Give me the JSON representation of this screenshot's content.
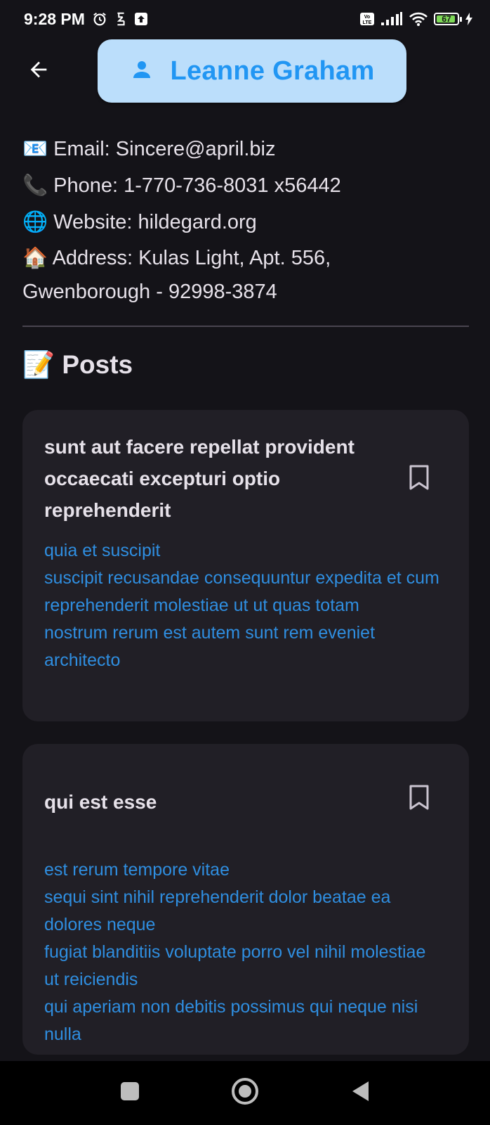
{
  "status_bar": {
    "time": "9:28 PM",
    "battery_percent": "67",
    "icons": [
      "alarm-icon",
      "data-saver-icon",
      "upload-icon",
      "volte-icon",
      "signal-icon",
      "wifi-icon",
      "battery-icon",
      "charging-icon"
    ]
  },
  "header": {
    "back_icon": "arrow-back-icon",
    "user_icon": "person-icon",
    "name": "Leanne Graham",
    "chip_bg": "#bbdefb",
    "chip_fg": "#2196f3"
  },
  "contact": {
    "email": "📧 Email: Sincere@april.biz",
    "phone": "📞 Phone: 1-770-736-8031 x56442",
    "website": "🌐 Website: hildegard.org",
    "address_line1": "🏠 Address: Kulas Light, Apt. 556,",
    "address_line2": "Gwenborough - 92998-3874"
  },
  "posts_heading": "📝 Posts",
  "posts": [
    {
      "title": "sunt aut facere repellat provident occaecati excepturi optio reprehenderit",
      "body_lines": [
        "quia et suscipit",
        "suscipit recusandae consequuntur expedita et cum",
        "reprehenderit molestiae ut ut quas totam",
        "nostrum rerum est autem sunt rem eveniet architecto"
      ],
      "bookmark_icon": "bookmark-outline-icon"
    },
    {
      "title": "qui est esse",
      "body_lines": [
        "est rerum tempore vitae",
        "sequi sint nihil reprehenderit dolor beatae ea dolores neque",
        "fugiat blanditiis voluptate porro vel nihil molestiae ut reiciendis",
        "qui aperiam non debitis possimus qui neque nisi nulla"
      ],
      "bookmark_icon": "bookmark-outline-icon"
    }
  ],
  "nav_bar": {
    "icons": [
      "recents-square-icon",
      "home-circle-icon",
      "back-triangle-icon"
    ]
  },
  "colors": {
    "background": "#141318",
    "card": "#211f26",
    "link_blue": "#2f8ee0",
    "text": "#e6e1e9"
  }
}
